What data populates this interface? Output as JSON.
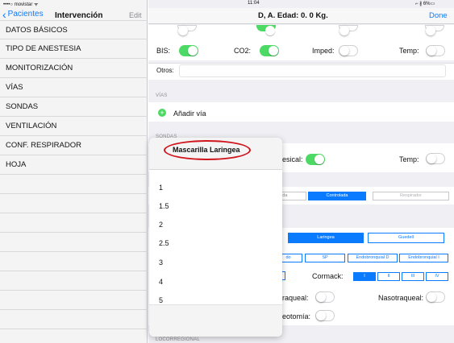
{
  "status_bar": {
    "left": "••••○ movistar ᯤ",
    "time": "11:04",
    "right": "⌐ ∦ 6%▭"
  },
  "nav": {
    "back_label": "Pacientes",
    "title": "Intervención",
    "edit": "Edit"
  },
  "sidebar": {
    "items": [
      {
        "label": "DATOS BÁSICOS"
      },
      {
        "label": "TIPO DE ANESTESIA"
      },
      {
        "label": "MONITORIZACIÓN"
      },
      {
        "label": "VÍAS"
      },
      {
        "label": "SONDAS"
      },
      {
        "label": "VENTILACIÓN"
      },
      {
        "label": "CONF. RESPIRADOR"
      },
      {
        "label": "HOJA"
      }
    ]
  },
  "header": {
    "title": "D, A. Edad: 0. 0 Kg.",
    "done": "Done"
  },
  "monitor": {
    "bis": "BIS:",
    "co2": "CO2:",
    "imped": "Imped:",
    "temp": "Temp:",
    "otros": "Otros:"
  },
  "vias": {
    "section": "VÍAS",
    "add": "Añadir vía"
  },
  "sondas": {
    "section": "SONDAS",
    "vesical": "esical:",
    "temp": "Temp:"
  },
  "vent": {
    "seg1": "istida",
    "seg2": "Controlada",
    "seg3": "Respirador"
  },
  "airway": {
    "laringea": "Laringea",
    "guedell": "Guedell",
    "s1": "do",
    "s2": "SP",
    "s3": "Endobronquial D",
    "s4": "Endobronquial I",
    "cormack": "Cormack:",
    "c1": "I",
    "c2": "II",
    "c3": "III",
    "c4": "IV",
    "traqueal": "raqueal:",
    "nasotraqueal": "Nasotraqueal:",
    "traqueotomia": "eotomía:"
  },
  "locorregional": {
    "section": "LOCORREGIONAL"
  },
  "popover": {
    "title": "Mascarilla Laringea",
    "options": [
      "1",
      "1.5",
      "2",
      "2.5",
      "3",
      "4",
      "5"
    ]
  }
}
